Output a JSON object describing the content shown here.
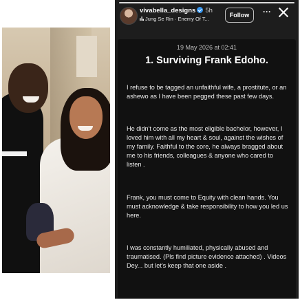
{
  "story": {
    "username": "vivabella_designs",
    "time_ago": "5h",
    "music": "Jung Se Rin · Enemy Of T...",
    "follow_label": "Follow",
    "more_label": "···",
    "date": "19 May 2026 at 02:41",
    "headline": "1. Surviving Frank Edoho.",
    "paragraphs": [
      "I refuse to be tagged an unfaithful wife, a prostitute, or an ashewo as I have been pegged these past few days.",
      "He didn't come as the most eligible bachelor, however, I loved him with all my heart & soul, against the wishes of my family. Faithful to the core, he always bragged about me to his friends, colleagues & anyone who cared to listen .",
      "Frank, you must come to Equity with clean hands. You must acknowledge & take responsibility to how you led us here.",
      "I was constantly humiliated, physically abused and traumatised. (Pls find picture evidence attached) . Videos Dey... but let's keep that one aside ."
    ]
  },
  "icons": {
    "verified": "verified-badge-icon",
    "music": "music-note-icon",
    "more": "more-options-icon",
    "close": "close-icon"
  },
  "colors": {
    "panel_bg": "#1d1d1d",
    "card_bg": "#111111",
    "verified_blue": "#3897f0"
  }
}
